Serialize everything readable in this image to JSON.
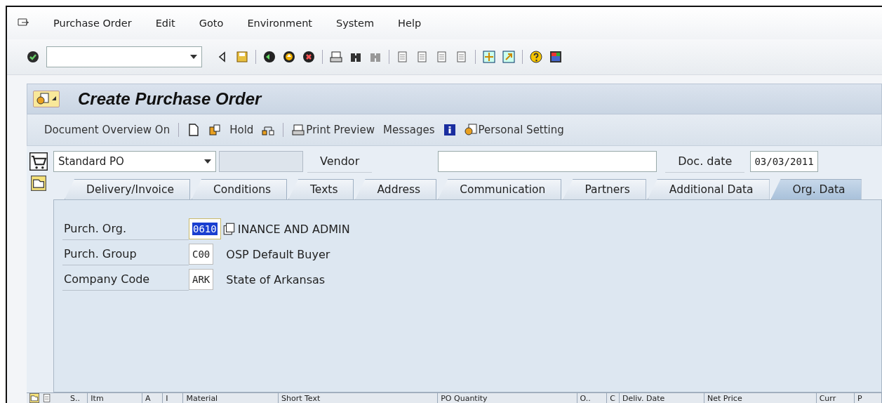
{
  "menu_bar": {
    "items": [
      {
        "label": "Purchase Order"
      },
      {
        "label": "Edit"
      },
      {
        "label": "Goto"
      },
      {
        "label": "Environment"
      },
      {
        "label": "System"
      },
      {
        "label": "Help"
      }
    ]
  },
  "title": "Create Purchase Order",
  "app_toolbar": {
    "items": [
      {
        "kind": "text",
        "label": "Document Overview On"
      },
      {
        "kind": "sep"
      },
      {
        "kind": "icon"
      },
      {
        "kind": "icon"
      },
      {
        "kind": "text",
        "label": "Hold"
      },
      {
        "kind": "icon"
      },
      {
        "kind": "sep"
      },
      {
        "kind": "icon_text",
        "label": "Print Preview"
      },
      {
        "kind": "text",
        "label": "Messages"
      },
      {
        "kind": "icon"
      },
      {
        "kind": "icon_text",
        "label": "Personal Setting"
      }
    ]
  },
  "header": {
    "doc_type": "Standard PO",
    "vendor_label": "Vendor",
    "doc_date_label": "Doc. date",
    "doc_date": "03/03/2011"
  },
  "tabs": [
    {
      "label": "Delivery/Invoice",
      "selected": false
    },
    {
      "label": "Conditions",
      "selected": false
    },
    {
      "label": "Texts",
      "selected": false
    },
    {
      "label": "Address",
      "selected": false
    },
    {
      "label": "Communication",
      "selected": false
    },
    {
      "label": "Partners",
      "selected": false
    },
    {
      "label": "Additional Data",
      "selected": false
    },
    {
      "label": "Org. Data",
      "selected": true
    }
  ],
  "org_fields": [
    {
      "label": "Purch. Org.",
      "value": "0610",
      "selected": true,
      "description": "INANCE AND ADMIN"
    },
    {
      "label": "Purch. Group",
      "value": "C00",
      "selected": false,
      "description": "OSP Default Buyer"
    },
    {
      "label": "Company Code",
      "value": "ARK",
      "selected": false,
      "description": "State of Arkansas"
    }
  ],
  "items_table": {
    "columns": [
      "S..",
      "Itm",
      "A",
      "I",
      "Material",
      "Short Text",
      "PO Quantity",
      "O..",
      "C",
      "Deliv. Date",
      "Net Price",
      "Curr",
      "P"
    ]
  }
}
